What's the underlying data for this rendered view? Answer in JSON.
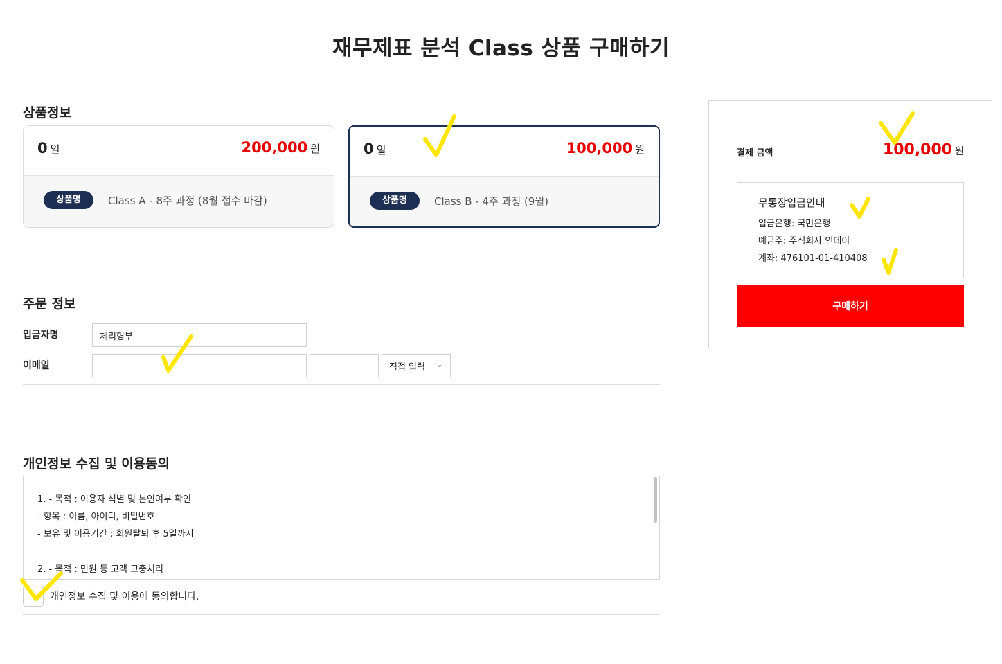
{
  "page": {
    "title": "재무제표 분석 Class 상품 구매하기"
  },
  "product_section": {
    "title": "상품정보",
    "products": [
      {
        "days": "0",
        "days_unit": "일",
        "price": "200,000",
        "price_unit": "원",
        "name_tag": "상품명",
        "name": "Class A - 8주 과정 (8월 접수 마감)",
        "selected": false
      },
      {
        "days": "0",
        "days_unit": "일",
        "price": "100,000",
        "price_unit": "원",
        "name_tag": "상품명",
        "name": "Class B - 4주 과정 (9월)",
        "selected": true
      }
    ]
  },
  "order_section": {
    "title": "주문 정보",
    "depositor_label": "입금자명",
    "depositor_value": "체리형부",
    "email_label": "이메일",
    "email_id_value": "",
    "email_domain_value": "",
    "email_select": "직접 입력"
  },
  "privacy_section": {
    "title": "개인정보 수집 및 이용동의",
    "terms_lines": [
      "1. - 목적 : 이용자 식별 및 본인여부 확인",
      "- 항목 : 이름, 아이디, 비밀번호",
      "- 보유 및 이용기간 : 회원탈퇴 후 5일까지",
      "",
      "2. - 목적 : 민원 등 고객 고충처리"
    ],
    "agree_label": "개인정보 수집 및 이용에 동의합니다.",
    "agree_checked": false
  },
  "payment": {
    "amount_label": "결제 금액",
    "amount": "100,000",
    "amount_unit": "원",
    "bank_title": "무통장입금안내",
    "bank_lines": [
      "입금은행: 국민은행",
      "예금주: 주식회사 인데이",
      "계좌: 476101-01-410408"
    ],
    "buy_button": "구매하기"
  },
  "colors": {
    "accent_red": "#e60000",
    "navy": "#1d2f52",
    "buy_button": "#ff0000",
    "highlight_marks": "#ffe600"
  }
}
